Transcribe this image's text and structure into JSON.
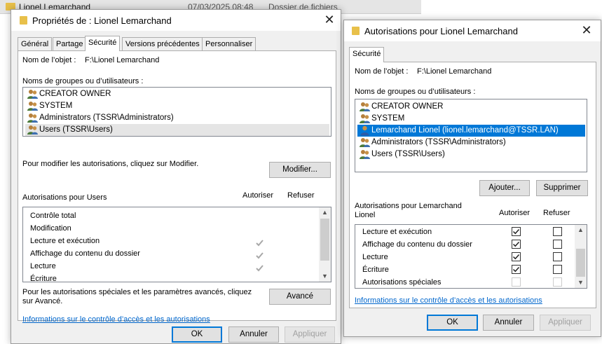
{
  "explorer_row": {
    "name": "Lionel Lemarchand",
    "date": "07/03/2025 08:48",
    "type": "Dossier de fichiers"
  },
  "properties_dialog": {
    "title": "Propriétés de : Lionel Lemarchand",
    "tabs": [
      "Général",
      "Partage",
      "Sécurité",
      "Versions précédentes",
      "Personnaliser"
    ],
    "active_tab": "Sécurité",
    "object_label": "Nom de l’objet :",
    "object_value": "F:\\Lionel Lemarchand",
    "groups_label": "Noms de groupes ou d’utilisateurs :",
    "principals": [
      "CREATOR OWNER",
      "SYSTEM",
      "Administrators (TSSR\\Administrators)",
      "Users (TSSR\\Users)"
    ],
    "highlighted_principal": "Users (TSSR\\Users)",
    "modify_hint": "Pour modifier les autorisations, cliquez sur Modifier.",
    "modify_button": "Modifier...",
    "perm_header": "Autorisations pour Users",
    "allow_col": "Autoriser",
    "deny_col": "Refuser",
    "permissions": [
      {
        "label": "Contrôle total",
        "allow": false
      },
      {
        "label": "Modification",
        "allow": false
      },
      {
        "label": "Lecture et exécution",
        "allow": true
      },
      {
        "label": "Affichage du contenu du dossier",
        "allow": true
      },
      {
        "label": "Lecture",
        "allow": true
      },
      {
        "label": "Écriture",
        "allow": false
      }
    ],
    "advanced_hint": "Pour les autorisations spéciales et les paramètres avancés, cliquez sur Avancé.",
    "advanced_button": "Avancé",
    "help_link": "Informations sur le contrôle d’accès et les autorisations",
    "ok": "OK",
    "cancel": "Annuler",
    "apply": "Appliquer"
  },
  "permissions_dialog": {
    "title": "Autorisations pour Lionel Lemarchand",
    "tab": "Sécurité",
    "object_label": "Nom de l’objet :",
    "object_value": "F:\\Lionel Lemarchand",
    "groups_label": "Noms de groupes ou d’utilisateurs :",
    "principals": [
      "CREATOR OWNER",
      "SYSTEM",
      "Lemarchand Lionel (lionel.lemarchand@TSSR.LAN)",
      "Administrators (TSSR\\Administrators)",
      "Users (TSSR\\Users)"
    ],
    "selected_principal": "Lemarchand Lionel (lionel.lemarchand@TSSR.LAN)",
    "add_button": "Ajouter...",
    "remove_button": "Supprimer",
    "perm_header_line1": "Autorisations pour Lemarchand",
    "perm_header_line2": "Lionel",
    "allow_col": "Autoriser",
    "deny_col": "Refuser",
    "permissions": [
      {
        "label": "Lecture et exécution",
        "allow": true,
        "deny": false,
        "disabled": false
      },
      {
        "label": "Affichage du contenu du dossier",
        "allow": true,
        "deny": false,
        "disabled": false
      },
      {
        "label": "Lecture",
        "allow": true,
        "deny": false,
        "disabled": false
      },
      {
        "label": "Écriture",
        "allow": true,
        "deny": false,
        "disabled": false
      },
      {
        "label": "Autorisations spéciales",
        "allow": false,
        "deny": false,
        "disabled": true
      }
    ],
    "help_link": "Informations sur le contrôle d’accès et les autorisations",
    "ok": "OK",
    "cancel": "Annuler",
    "apply": "Appliquer"
  },
  "colors": {
    "selection": "#0078d7",
    "link": "#0066cc",
    "dialog_bg": "#f0f0f0",
    "folder": "#e8c04a"
  },
  "icons": {
    "folder": "folder-icon",
    "user_group": "user-group-icon",
    "user": "user-icon",
    "close": "close-icon",
    "check": "check-icon"
  }
}
